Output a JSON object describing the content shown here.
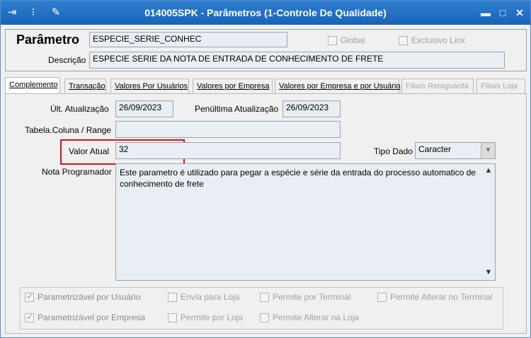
{
  "window": {
    "title": "014005SPK - Parâmetros (1-Controle De Qualidade)"
  },
  "titlebar_icons": [
    "exit-icon",
    "traffic-light-icon",
    "wrench-icon"
  ],
  "window_buttons": {
    "minimize": "▬",
    "restore": "□",
    "close": "✕"
  },
  "header": {
    "param_label": "Parâmetro",
    "param_value": "ESPECIE_SERIE_CONHEC",
    "global_label": "Global",
    "exclusivo_label": "Exclusivo Linx",
    "descricao_label": "Descrição",
    "descricao_value": "ESPECIE SERIE DA NOTA DE ENTRADA DE CONHECIMENTO DE FRETE"
  },
  "tabs": [
    {
      "label": "Complemento"
    },
    {
      "label": "Transação"
    },
    {
      "label": "Valores Por Usuários"
    },
    {
      "label": "Valores por Empresa"
    },
    {
      "label": "Valores por Empresa e por Usuário"
    },
    {
      "label": "Filiais Retaguarda"
    },
    {
      "label": "Filiais Loja"
    }
  ],
  "form": {
    "ult_label": "Últ. Atualização",
    "ult_value": "26/09/2023",
    "penult_label": "Penúltima Atualização",
    "penult_value": "26/09/2023",
    "tabela_label": "Tabela.Coluna / Range",
    "tabela_value": "",
    "valor_label": "Valor Atual",
    "valor_value": "32",
    "tipo_label": "Tipo Dado",
    "tipo_value": "Caracter",
    "nota_label": "Nota Programador",
    "nota_value": "Este parametro é utilizado para pegar a espécie e série da entrada do processo automatico de conhecimento de frete"
  },
  "options": {
    "param_usuario": "Parametrizável por Usuário",
    "envia_loja": "Envia para Loja",
    "permite_terminal": "Permite por Terminal",
    "permite_alterar_terminal": "Permite Alterar no Terminal",
    "param_empresa": "Parametrizável por Empresa",
    "permite_loja": "Permite por Loja",
    "permite_alterar_loja": "Permite Alterar na Loja"
  },
  "colors": {
    "titlebar": "#1863b8",
    "highlight": "#e01010"
  }
}
